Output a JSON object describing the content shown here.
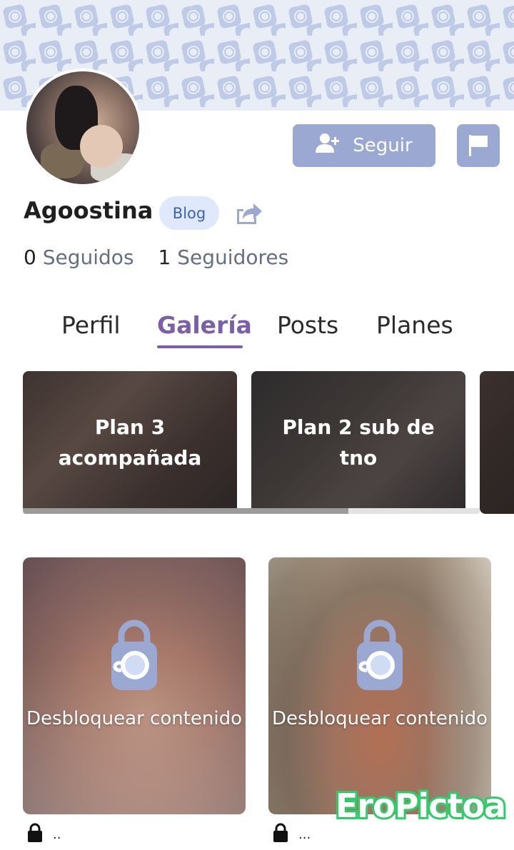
{
  "profile": {
    "name": "Agoostina",
    "badge": "Blog",
    "follow_label": "Seguir",
    "stats": [
      {
        "count": "0",
        "label": "Seguidos"
      },
      {
        "count": "1",
        "label": "Seguidores"
      }
    ]
  },
  "tabs": [
    {
      "label": "Perfil",
      "active": false
    },
    {
      "label": "Galería",
      "active": true
    },
    {
      "label": "Posts",
      "active": false
    },
    {
      "label": "Planes",
      "active": false
    }
  ],
  "plans": [
    {
      "title": "Plan 3 acompañada"
    },
    {
      "title": "Plan 2 sub de tno"
    }
  ],
  "gallery": [
    {
      "unlock_label": "Desbloquear contenido",
      "caption": ".."
    },
    {
      "unlock_label": "Desbloquear contenido",
      "caption": "..."
    }
  ],
  "watermark": "EroPictoa",
  "colors": {
    "accent": "#7b5fa8",
    "button": "#9aa8d2",
    "badge_bg": "#dfe9fb",
    "badge_text": "#3e63b2",
    "banner_bg": "#e9edf6"
  },
  "icons": {
    "follow": "user-plus-icon",
    "report": "flag-icon",
    "share": "share-icon",
    "locked": "padlock-cup-icon",
    "caption_lock": "lock-icon"
  }
}
